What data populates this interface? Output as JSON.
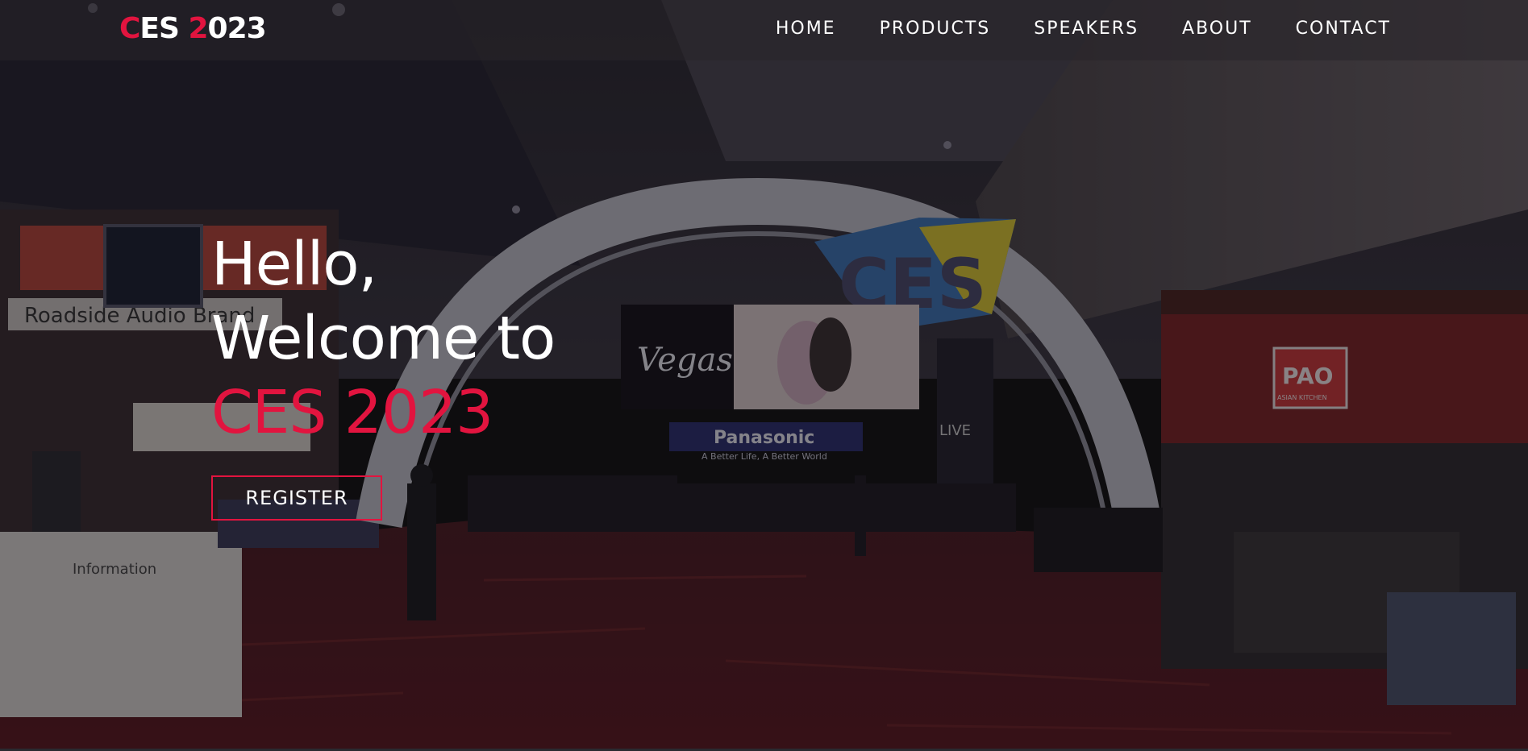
{
  "header": {
    "logo": {
      "c": "C",
      "es": "ES ",
      "two": "2",
      "rest": "023"
    },
    "nav": [
      {
        "label": "HOME"
      },
      {
        "label": "PRODUCTS"
      },
      {
        "label": "SPEAKERS"
      },
      {
        "label": "ABOUT"
      },
      {
        "label": "CONTACT"
      }
    ]
  },
  "hero": {
    "line1": "Hello,",
    "line2": "Welcome to",
    "line3": "CES 2023",
    "register_label": "REGISTER"
  },
  "background": {
    "signs": {
      "ces": "CES",
      "vegas": "Vegas",
      "panasonic": "Panasonic",
      "panasonic_tagline": "A Better Life, A Better World",
      "pao": "PAO",
      "pao_sub": "ASIAN KITCHEN",
      "live": "LIVE",
      "audio": "Roadside Audio Brand",
      "information": "Information"
    }
  },
  "colors": {
    "accent": "#e2143f",
    "text": "#ffffff"
  }
}
